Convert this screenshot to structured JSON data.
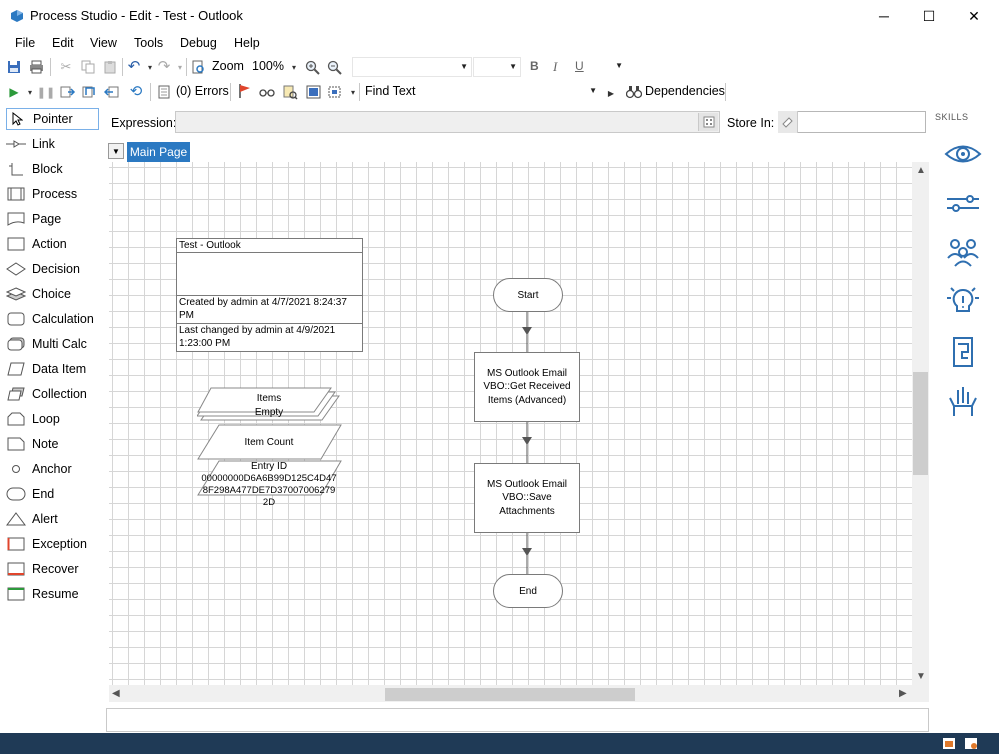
{
  "window": {
    "title": "Process Studio  - Edit - Test - Outlook",
    "minimize": "─",
    "maximize": "☐",
    "close": "✕"
  },
  "menu": [
    "File",
    "Edit",
    "View",
    "Tools",
    "Debug",
    "Help"
  ],
  "toolbar1": {
    "zoom_label": "Zoom",
    "zoom_value": "100%",
    "bold": "B",
    "italic": "I",
    "underline": "U"
  },
  "toolbar2": {
    "errors_label": "(0) Errors",
    "find_text": "Find Text",
    "dependencies": "Dependencies"
  },
  "toolbox": [
    {
      "label": "Pointer",
      "icon": "pointer-icon"
    },
    {
      "label": "Link",
      "icon": "link-icon"
    },
    {
      "label": "Block",
      "icon": "block-icon"
    },
    {
      "label": "Process",
      "icon": "process-icon"
    },
    {
      "label": "Page",
      "icon": "page-icon"
    },
    {
      "label": "Action",
      "icon": "action-icon"
    },
    {
      "label": "Decision",
      "icon": "decision-icon"
    },
    {
      "label": "Choice",
      "icon": "choice-icon"
    },
    {
      "label": "Calculation",
      "icon": "calculation-icon"
    },
    {
      "label": "Multi Calc",
      "icon": "multi-calc-icon"
    },
    {
      "label": "Data Item",
      "icon": "data-item-icon"
    },
    {
      "label": "Collection",
      "icon": "collection-icon"
    },
    {
      "label": "Loop",
      "icon": "loop-icon"
    },
    {
      "label": "Note",
      "icon": "note-icon"
    },
    {
      "label": "Anchor",
      "icon": "anchor-icon"
    },
    {
      "label": "End",
      "icon": "end-icon"
    },
    {
      "label": "Alert",
      "icon": "alert-icon"
    },
    {
      "label": "Exception",
      "icon": "exception-icon"
    },
    {
      "label": "Recover",
      "icon": "recover-icon"
    },
    {
      "label": "Resume",
      "icon": "resume-icon"
    }
  ],
  "expression": {
    "label": "Expression:",
    "value": "",
    "store_label": "Store In:",
    "store_value": ""
  },
  "tabs": [
    {
      "label": "Main Page",
      "active": true
    }
  ],
  "skills": {
    "label": "SKILLS",
    "icons": [
      "eye-icon",
      "slider-icon",
      "people-icon",
      "idea-icon",
      "document-icon",
      "hand-icon"
    ]
  },
  "canvas": {
    "info": {
      "title": "Test - Outlook",
      "created": "Created by admin at 4/7/2021 8:24:37 PM",
      "changed": "Last changed by admin at 4/9/2021 1:23:00 PM"
    },
    "collection_items": {
      "name": "Items",
      "value": "Empty"
    },
    "data_item_count": {
      "name": "Item Count"
    },
    "data_entry_id": {
      "name": "Entry ID",
      "value": "00000000D6A6B99D125C4D478F298A477DE7D37007006279 2D"
    },
    "start": "Start",
    "action1": "MS Outlook Email VBO::Get Received Items (Advanced)",
    "action2": "MS Outlook Email VBO::Save Attachments",
    "end": "End"
  },
  "colors": {
    "accent": "#2b79c2",
    "taskbar": "#1f3a56",
    "skill_icon": "#2f6fb0"
  }
}
